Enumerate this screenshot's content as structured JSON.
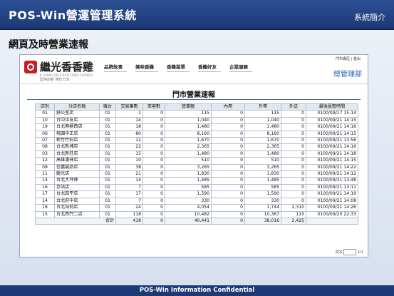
{
  "slide": {
    "title": "POS-Win營運管理系統",
    "intro": "系統簡介",
    "subtitle": "網頁及時營業速報",
    "footer": "POS-Win Information Confidential"
  },
  "app": {
    "logo_name": "繼光香香雞",
    "logo_en": "JI GUANG DELICIOUS FRIED CHICKEN",
    "logo_sub": "堅持創新  樂於分享",
    "nav": [
      "品牌故事",
      "美味香雞",
      "香雞菜單",
      "香雞好友",
      "企業服務"
    ],
    "toplinks": "門市專區 | 登出",
    "admin_label": "總管理部",
    "report_title": "門市營業速報"
  },
  "table": {
    "headers": [
      "店別",
      "分店名稱",
      "機台",
      "交易筆數",
      "來客數",
      "營業額",
      "內用",
      "外帶",
      "外送",
      "最後匯整時間"
    ],
    "rows": [
      [
        "01",
        "辦公室店",
        "01",
        "1",
        "0",
        "115",
        "0",
        "115",
        "0",
        "0100/09/17 15:14"
      ],
      [
        "10",
        "台中中友店",
        "01",
        "14",
        "0",
        "1,040",
        "0",
        "1,040",
        "0",
        "0100/09/21 14:15"
      ],
      [
        "19",
        "台北興櫃西店",
        "01",
        "18",
        "0",
        "1,480",
        "0",
        "1,480",
        "0",
        "0100/09/21 14:16"
      ],
      [
        "06",
        "桃園中正店",
        "01",
        "80",
        "0",
        "8,160",
        "0",
        "8,160",
        "0",
        "0100/09/21 14:15"
      ],
      [
        "07",
        "新竹竹科店",
        "01",
        "12",
        "0",
        "1,670",
        "0",
        "1,670",
        "0",
        "0100/09/21 13:56"
      ],
      [
        "08",
        "台北新埔店",
        "01",
        "22",
        "0",
        "2,365",
        "0",
        "2,365",
        "0",
        "0100/09/21 14:16"
      ],
      [
        "03",
        "台北新莊店",
        "01",
        "15",
        "0",
        "1,480",
        "0",
        "1,480",
        "0",
        "0100/09/21 14:18"
      ],
      [
        "12",
        "高雄漢神店",
        "01",
        "10",
        "0",
        "510",
        "0",
        "510",
        "0",
        "0100/09/21 14:15"
      ],
      [
        "09",
        "信義誠品店",
        "01",
        "38",
        "0",
        "3,265",
        "0",
        "3,265",
        "0",
        "0100/09/21 14:22"
      ],
      [
        "11",
        "龍光店",
        "01",
        "21",
        "0",
        "1,830",
        "0",
        "1,830",
        "0",
        "0100/09/21 14:12"
      ],
      [
        "14",
        "台北大坪林",
        "01",
        "14",
        "0",
        "1,485",
        "0",
        "1,485",
        "0",
        "0100/09/21 13:48"
      ],
      [
        "16",
        "京站店",
        "01",
        "7",
        "0",
        "585",
        "0",
        "585",
        "0",
        "0100/09/21 13:11"
      ],
      [
        "17",
        "台北四平店",
        "01",
        "17",
        "0",
        "1,590",
        "0",
        "1,590",
        "0",
        "0100/09/21 14:19"
      ],
      [
        "14",
        "台北府中店",
        "01",
        "7",
        "0",
        "330",
        "0",
        "330",
        "0",
        "0100/09/21 14:08"
      ],
      [
        "18",
        "台北站前店",
        "01",
        "24",
        "0",
        "4,054",
        "0",
        "1,744",
        "2,310",
        "0100/09/21 14:26"
      ],
      [
        "15",
        "台北西門二店",
        "01",
        "118",
        "0",
        "10,482",
        "0",
        "10,367",
        "115",
        "0100/09/20 22:33"
      ]
    ],
    "totals": {
      "label": "合計",
      "transactions": "418",
      "customers": "0",
      "sales": "40,441",
      "dine_in": "0",
      "takeout": "38,016",
      "delivery": "2,425"
    }
  },
  "pager": {
    "label": "頁次",
    "page": "1/1"
  }
}
